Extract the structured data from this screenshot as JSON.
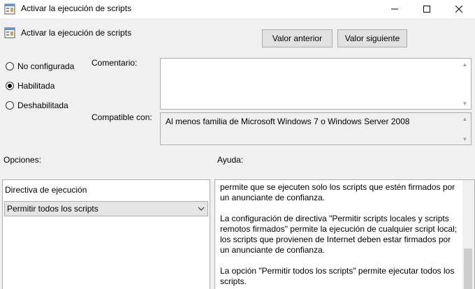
{
  "window": {
    "title": "Activar la ejecución de scripts"
  },
  "header": {
    "policy_name": "Activar la ejecución de scripts",
    "prev_button": "Valor anterior",
    "next_button": "Valor siguiente"
  },
  "state": {
    "options": [
      {
        "label": "No configurada",
        "selected": false
      },
      {
        "label": "Habilitada",
        "selected": true
      },
      {
        "label": "Deshabilitada",
        "selected": false
      }
    ]
  },
  "comment": {
    "label": "Comentario:",
    "value": ""
  },
  "compatible": {
    "label": "Compatible con:",
    "value": "Al menos familia de Microsoft Windows 7 o Windows Server 2008"
  },
  "options_section": {
    "label": "Opciones:",
    "field_label": "Directiva de ejecución",
    "selected_value": "Permitir todos los scripts"
  },
  "help_section": {
    "label": "Ayuda:",
    "paragraphs": [
      "permite que se ejecuten solo los scripts que estén firmados por un anunciante de confianza.",
      "La configuración de directiva \"Permitir scripts locales y scripts remotos firmados\" permite la ejecución de cualquier script local; los scripts que provienen de Internet deben estar firmados por un anunciante de confianza.",
      "La opción \"Permitir todos los scripts\" permite ejecutar todos los scripts."
    ]
  },
  "colors": {
    "background": "#f0f0f0",
    "button_face": "#e1e1e1",
    "border": "#adadad"
  }
}
